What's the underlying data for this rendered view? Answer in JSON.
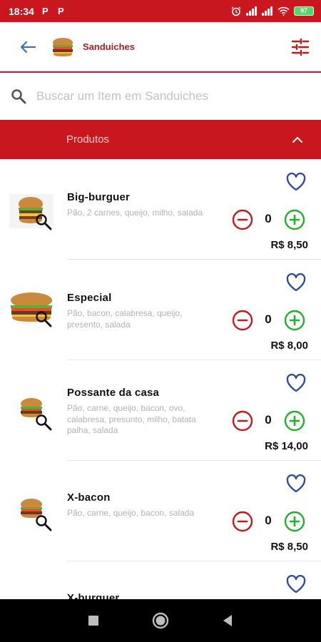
{
  "status_bar": {
    "time": "18:34",
    "notification_icons": [
      "P",
      "P"
    ],
    "battery": "97"
  },
  "header": {
    "title": "Sanduiches",
    "back_icon": "arrow-left-icon",
    "filter_icon": "sliders-icon"
  },
  "search": {
    "placeholder": "Buscar um Item em Sanduiches",
    "value": ""
  },
  "section": {
    "title": "Produtos",
    "expanded": true
  },
  "colors": {
    "brand_red": "#c8171e",
    "title_red": "#b01d23",
    "minus_red": "#c8171e",
    "plus_green": "#22b02c",
    "heart_blue": "#2f4f9a"
  },
  "products": [
    {
      "name": "Big-burguer",
      "description": "Pão, 2 carnes, queijo, milho, salada",
      "quantity": "0",
      "price": "R$ 8,50"
    },
    {
      "name": "Especial",
      "description": "Pão, bacon, calabresa, queijo, presento, salada",
      "quantity": "0",
      "price": "R$ 8,00"
    },
    {
      "name": "Possante da casa",
      "description": "Pão, carne, queijo, bacon, ovo, calabresa, presunto, milho, batata palha, salada",
      "quantity": "0",
      "price": "R$ 14,00"
    },
    {
      "name": "X-bacon",
      "description": "Pão, carne, queijo, bacon, salada",
      "quantity": "0",
      "price": "R$ 8,50"
    },
    {
      "name": "X-burguer",
      "description": "",
      "quantity": "",
      "price": ""
    }
  ]
}
